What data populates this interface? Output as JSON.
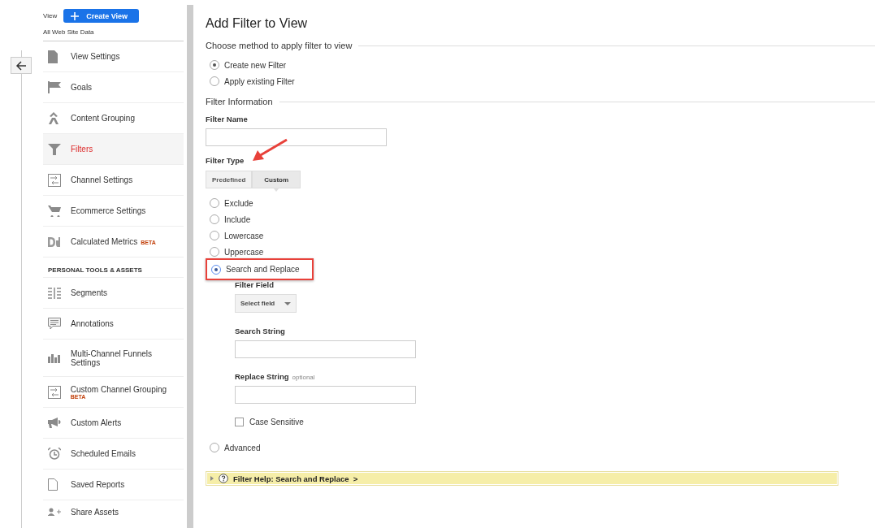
{
  "sidebar": {
    "view_label": "View",
    "create_button": "Create View",
    "view_name": "All Web Site Data",
    "items": [
      {
        "label": "View Settings",
        "selected": false
      },
      {
        "label": "Goals",
        "selected": false
      },
      {
        "label": "Content Grouping",
        "selected": false
      },
      {
        "label": "Filters",
        "selected": true
      },
      {
        "label": "Channel Settings",
        "selected": false
      },
      {
        "label": "Ecommerce Settings",
        "selected": false
      },
      {
        "label": "Calculated Metrics",
        "badge": "BETA",
        "selected": false
      }
    ],
    "section_header": "PERSONAL TOOLS & ASSETS",
    "tools": [
      {
        "label": "Segments",
        "selected": false
      },
      {
        "label": "Annotations",
        "selected": false
      },
      {
        "label": "Multi-Channel Funnels Settings",
        "selected": false
      },
      {
        "label": "Custom Channel Grouping",
        "badge": "BETA",
        "selected": false
      },
      {
        "label": "Custom Alerts",
        "selected": false
      },
      {
        "label": "Scheduled Emails",
        "selected": false
      },
      {
        "label": "Saved Reports",
        "selected": false
      },
      {
        "label": "Share Assets",
        "selected": false
      }
    ]
  },
  "main": {
    "title": "Add Filter to View",
    "method": {
      "legend": "Choose method to apply filter to view",
      "options": [
        {
          "label": "Create new Filter",
          "selected": true
        },
        {
          "label": "Apply existing Filter",
          "selected": false
        }
      ]
    },
    "info": {
      "legend": "Filter Information",
      "filter_name_label": "Filter Name",
      "filter_type_label": "Filter Type",
      "type_tabs": [
        {
          "label": "Predefined",
          "selected": false
        },
        {
          "label": "Custom",
          "selected": true
        }
      ],
      "types": [
        {
          "label": "Exclude",
          "selected": false,
          "highlighted": false
        },
        {
          "label": "Include",
          "selected": false,
          "highlighted": false
        },
        {
          "label": "Lowercase",
          "selected": false,
          "highlighted": false
        },
        {
          "label": "Uppercase",
          "selected": false,
          "highlighted": false
        },
        {
          "label": "Search and Replace",
          "selected": true,
          "highlighted": true
        }
      ],
      "filter_field_label": "Filter Field",
      "select_field": "Select field",
      "search_string_label": "Search String",
      "replace_string_label": "Replace String",
      "replace_hint": "optional",
      "case_sensitive": {
        "label": "Case Sensitive",
        "checked": false
      },
      "advanced": {
        "label": "Advanced",
        "selected": false
      },
      "help": {
        "text": "Filter Help: Search and Replace  >",
        "expanded": false
      }
    }
  }
}
